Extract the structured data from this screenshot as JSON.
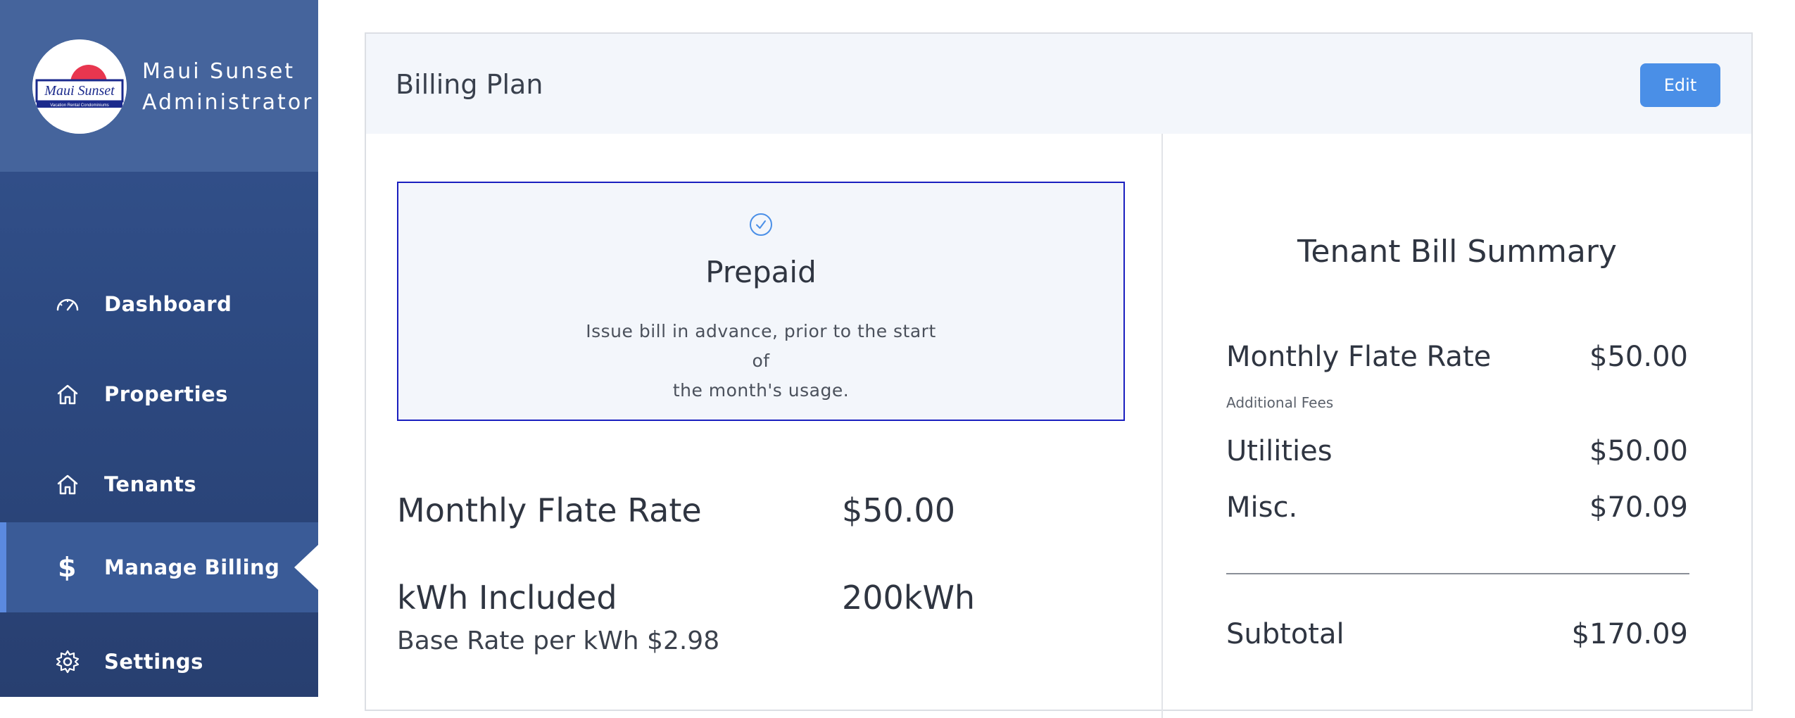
{
  "sidebar": {
    "logo_alt": "Maui Sunset Vacation Rental Condominiums",
    "logo_text": "Maui Sunset",
    "logo_subtext": "Vacation Rental Condominiums",
    "title_line1": "Maui Sunset",
    "title_line2": "Administrator",
    "items": [
      {
        "label": "Dashboard",
        "icon": "speedometer-icon"
      },
      {
        "label": "Properties",
        "icon": "home-icon"
      },
      {
        "label": "Tenants",
        "icon": "home-icon"
      },
      {
        "label": "Manage Billing",
        "icon": "dollar-icon",
        "active": true,
        "glyph": "$"
      },
      {
        "label": "Settings",
        "icon": "gear-icon"
      }
    ]
  },
  "billing": {
    "title": "Billing Plan",
    "edit_label": "Edit",
    "plan": {
      "name": "Prepaid",
      "description_line1": "Issue bill in advance, prior to the start of",
      "description_line2": "the month's usage.",
      "selected": true
    },
    "details": {
      "monthly_rate_label": "Monthly Flate Rate",
      "monthly_rate_value": "$50.00",
      "kwh_label": "kWh Included",
      "kwh_value": "200kWh",
      "base_rate_text": "Base Rate per kWh $2.98"
    }
  },
  "summary": {
    "title": "Tenant Bill Summary",
    "monthly_rate_label": "Monthly Flate Rate",
    "monthly_rate_value": "$50.00",
    "additional_fees_label": "Additional Fees",
    "utilities_label": "Utilities",
    "utilities_value": "$50.00",
    "misc_label": "Misc.",
    "misc_value": "$70.09",
    "subtotal_label": "Subtotal",
    "subtotal_value": "$170.09"
  },
  "colors": {
    "sidebar_bg": "#2d4a82",
    "sidebar_header_bg": "#45649c",
    "active_item_bg": "#3a5b97",
    "active_accent": "#5b8ae0",
    "edit_button": "#4a8fe7",
    "selected_border": "#1a1fbf",
    "panel_bg": "#f3f6fb"
  }
}
